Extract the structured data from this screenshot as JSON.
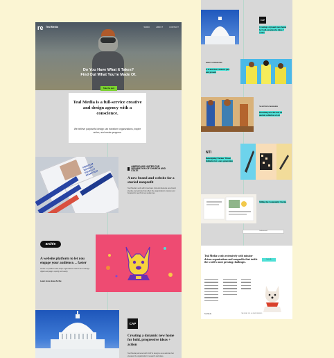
{
  "hero": {
    "logo": "re",
    "brand": "Teal Media",
    "nav": [
      "WORK",
      "ABOUT",
      "CONTACT"
    ],
    "headline_line1": "Do You Have What It Takes?",
    "headline_line2": "Find Out What You're Made Of.",
    "cta": "Take the quiz"
  },
  "intro": {
    "title": "Teal Media is a full-service creative and design agency with a conscience.",
    "body": "We believe purposeful design can transform organizations, inspire action, and create progress."
  },
  "projects": [
    {
      "logo_text": "AMERICANS UNITED FOR SEPARATION OF CHURCH AND STATE",
      "title": "A new brand and website for a storied nonprofit",
      "body": "Teal Media's work with Americans United included a new brand identity and website that reflect the organization's mission and broaden its reach to new audiences.",
      "image_text": [
        "FREEDOM",
        "WITHOUT",
        "EQUALITY",
        "EXCEPTION"
      ]
    },
    {
      "logo_text": "archie",
      "title": "A website platform to let you engage your audience… faster",
      "body": "Archie is a platform that helps organizations launch and manage digital campaigns quickly and easily.",
      "link": "Learn more about Archie"
    },
    {
      "logo_text": "CAP",
      "title": "Creating a dynamic new home for bold, progressive ideas + action",
      "body": "Teal Media partnered with CAP to design a new website that elevates the organization's research and ideas."
    }
  ],
  "right": {
    "items": [
      {
        "logo": "CAP",
        "title": "Creating a dynamic new home for bold, progressive ideas + action"
      },
      {
        "logo": "AMNESTY INTERNATIONAL",
        "title": "A brand that connects past and present"
      },
      {
        "logo": "THE METROPOLITAN MUSEUM",
        "title": "Breathing new life into an ancient collection of art"
      },
      {
        "logo": "NTI",
        "title": "Redesigning Nuclear Threat Initiative for a new generation"
      },
      {
        "logo": "",
        "title": "Telling the Community Stories"
      }
    ],
    "load_more": "Load more work",
    "footer": {
      "title": "Teal Media works extensively with mission-driven organizations and nonprofits that tackle the world's most pressing challenges.",
      "button": "Let's talk",
      "brand": "Teal Media",
      "legal": "TEAL MEDIA © 2024  ·  ALL RIGHTS RESERVED"
    }
  }
}
